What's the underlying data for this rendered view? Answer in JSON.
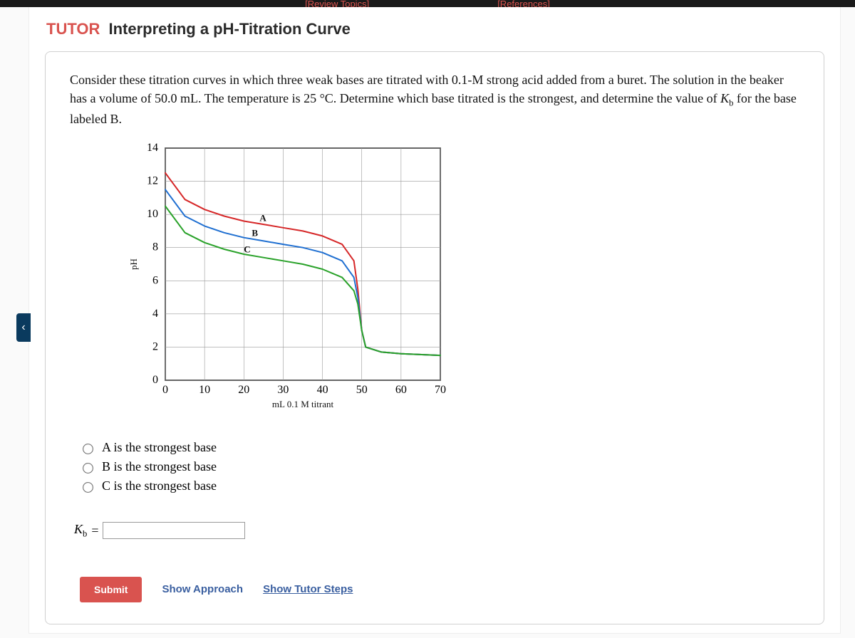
{
  "topbar": {
    "review_topics": "[Review Topics]",
    "references": "[References]"
  },
  "title": {
    "brand": "TUTOR",
    "text": "Interpreting a pH-Titration Curve"
  },
  "prompt_html": "Consider these titration curves in which three weak bases are titrated with 0.1-M strong acid added from a buret. The solution in the beaker has a volume of 50.0 mL. The temperature is 25 °C. Determine which base titrated is the strongest, and determine the value of <i>K</i><sub>b</sub> for the base labeled B.",
  "chart_data": {
    "type": "line",
    "title": "",
    "xlabel": "mL 0.1 M titrant",
    "ylabel": "pH",
    "xlim": [
      0,
      70
    ],
    "ylim": [
      0,
      14
    ],
    "xticks": [
      0,
      10,
      20,
      30,
      40,
      50,
      60,
      70
    ],
    "yticks": [
      0,
      2,
      4,
      6,
      8,
      10,
      12,
      14
    ],
    "series": [
      {
        "name": "A",
        "color": "#d62728",
        "x": [
          0,
          5,
          10,
          15,
          20,
          25,
          30,
          35,
          40,
          45,
          48,
          49,
          50,
          51,
          55,
          60,
          70
        ],
        "y": [
          12.5,
          10.9,
          10.3,
          9.9,
          9.6,
          9.4,
          9.2,
          9.0,
          8.7,
          8.2,
          7.2,
          5.5,
          3.0,
          2.0,
          1.7,
          1.6,
          1.5
        ]
      },
      {
        "name": "B",
        "color": "#1f6fd1",
        "x": [
          0,
          5,
          10,
          15,
          20,
          25,
          30,
          35,
          40,
          45,
          48,
          49,
          50,
          51,
          55,
          60,
          70
        ],
        "y": [
          11.5,
          9.9,
          9.3,
          8.9,
          8.6,
          8.4,
          8.2,
          8.0,
          7.7,
          7.2,
          6.2,
          5.0,
          3.0,
          2.0,
          1.7,
          1.6,
          1.5
        ]
      },
      {
        "name": "C",
        "color": "#2aa22a",
        "x": [
          0,
          5,
          10,
          15,
          20,
          25,
          30,
          35,
          40,
          45,
          48,
          49,
          50,
          51,
          55,
          60,
          70
        ],
        "y": [
          10.5,
          8.9,
          8.3,
          7.9,
          7.6,
          7.4,
          7.2,
          7.0,
          6.7,
          6.2,
          5.4,
          4.6,
          3.0,
          2.0,
          1.7,
          1.6,
          1.5
        ]
      }
    ],
    "series_label_positions": {
      "A": {
        "x": 24,
        "y": 9.6
      },
      "B": {
        "x": 22,
        "y": 8.7
      },
      "C": {
        "x": 20,
        "y": 7.7
      }
    }
  },
  "options": [
    {
      "id": "optA",
      "label": "A is the strongest base"
    },
    {
      "id": "optB",
      "label": "B is the strongest base"
    },
    {
      "id": "optC",
      "label": "C is the strongest base"
    }
  ],
  "kb": {
    "label_prefix": "K",
    "label_sub": "b",
    "equals": "=",
    "value": ""
  },
  "actions": {
    "submit": "Submit",
    "show_approach": "Show Approach",
    "show_tutor": "Show Tutor Steps"
  }
}
